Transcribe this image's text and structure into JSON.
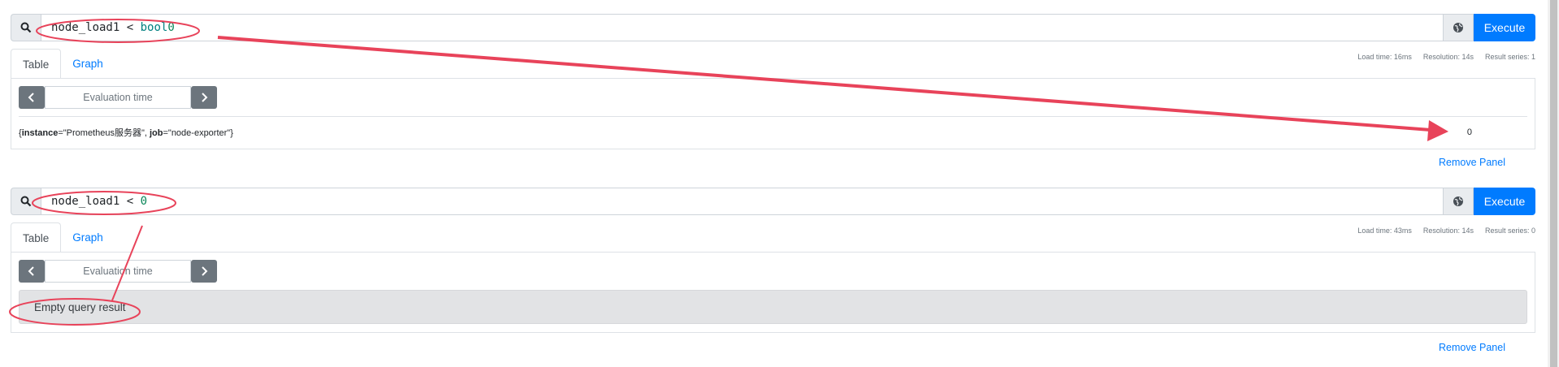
{
  "panels": [
    {
      "query": {
        "metric": "node_load1",
        "op": " < ",
        "kw": "bool",
        "num": "0"
      },
      "execute_label": "Execute",
      "tabs": [
        "Table",
        "Graph"
      ],
      "stats": {
        "load_time": "Load time: 16ms",
        "resolution": "Resolution: 14s",
        "series": "Result series: 1"
      },
      "eval_label": "Evaluation time",
      "result": {
        "open": "{",
        "k1": "instance",
        "v1": "=\"Prometheus服务器\", ",
        "k2": "job",
        "v2": "=\"node-exporter\"}",
        "value": "0"
      },
      "remove_label": "Remove Panel"
    },
    {
      "query": {
        "metric": "node_load1",
        "op": " < ",
        "num": "0"
      },
      "execute_label": "Execute",
      "tabs": [
        "Table",
        "Graph"
      ],
      "stats": {
        "load_time": "Load time: 43ms",
        "resolution": "Resolution: 14s",
        "series": "Result series: 0"
      },
      "eval_label": "Evaluation time",
      "empty_label": "Empty query result",
      "remove_label": "Remove Panel"
    }
  ],
  "colors": {
    "accent": "#007bff",
    "annotation": "#e8435a"
  }
}
